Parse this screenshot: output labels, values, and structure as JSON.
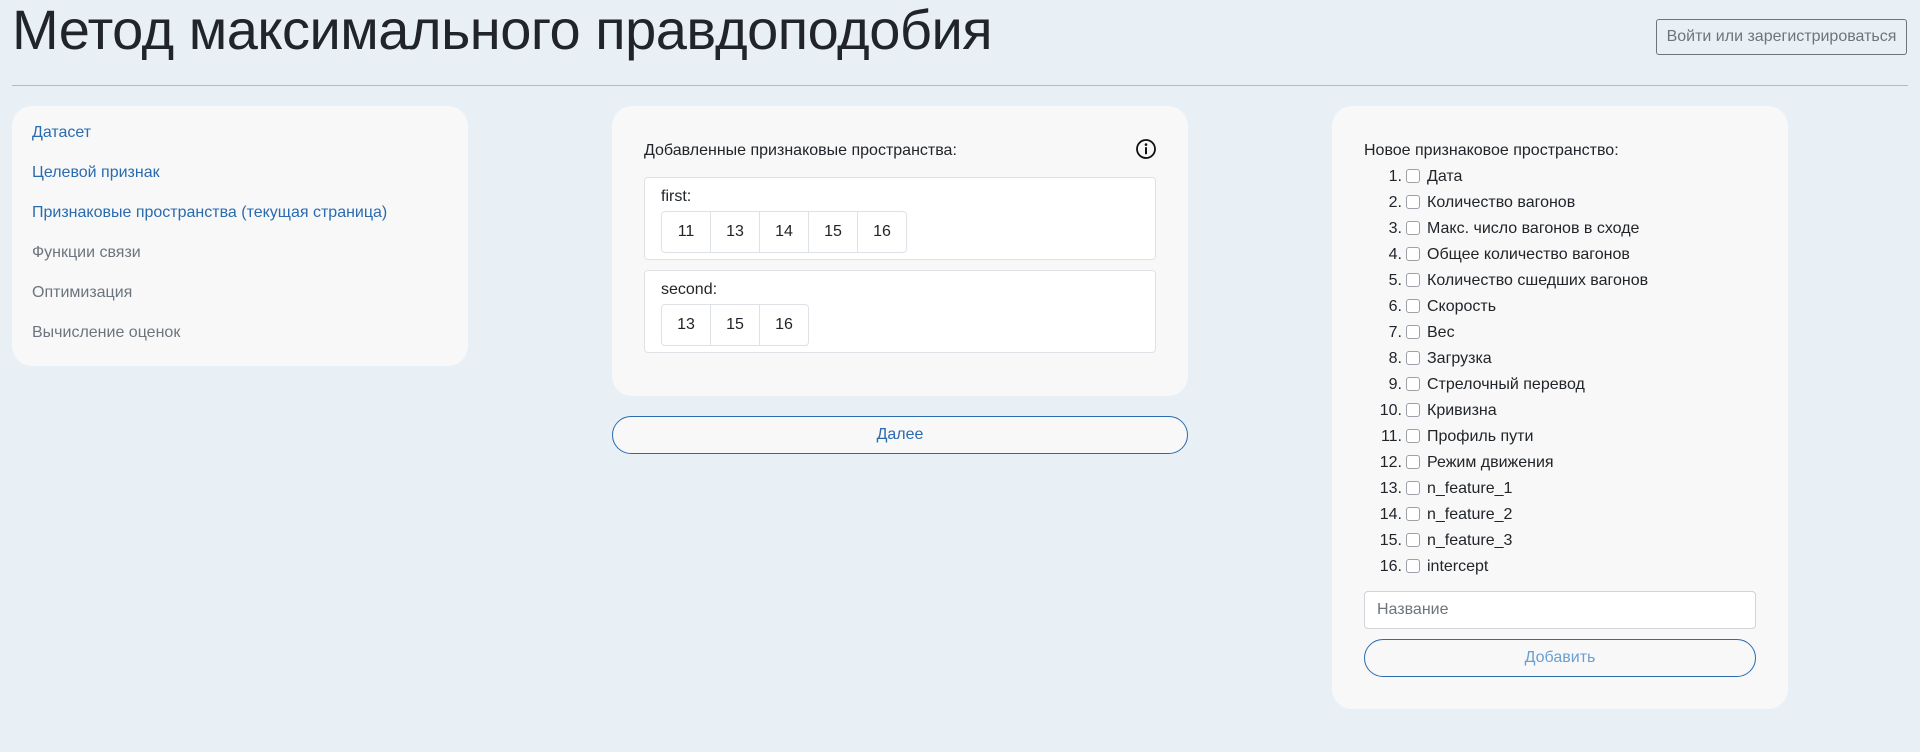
{
  "header": {
    "title": "Метод максимального правдоподобия",
    "login_label": "Войти или зарегистрироваться"
  },
  "nav": {
    "items": [
      {
        "label": "Датасет",
        "state": "link"
      },
      {
        "label": "Целевой признак",
        "state": "link"
      },
      {
        "label": "Признаковые пространства (текущая страница)",
        "state": "link"
      },
      {
        "label": "Функции связи",
        "state": "muted"
      },
      {
        "label": "Оптимизация",
        "state": "muted"
      },
      {
        "label": "Вычисление оценок",
        "state": "muted"
      }
    ]
  },
  "spaces": {
    "title": "Добавленные признаковые пространства:",
    "info_icon": "info-circle-icon",
    "items": [
      {
        "name": "first:",
        "features": [
          "11",
          "13",
          "14",
          "15",
          "16"
        ]
      },
      {
        "name": "second:",
        "features": [
          "13",
          "15",
          "16"
        ]
      }
    ],
    "next_label": "Далее"
  },
  "new_space": {
    "title": "Новое признаковое пространство:",
    "features": [
      {
        "num": "1.",
        "label": "Дата"
      },
      {
        "num": "2.",
        "label": "Количество вагонов"
      },
      {
        "num": "3.",
        "label": "Макс. число вагонов в сходе"
      },
      {
        "num": "4.",
        "label": "Общее количество вагонов"
      },
      {
        "num": "5.",
        "label": "Количество сшедших вагонов"
      },
      {
        "num": "6.",
        "label": "Скорость"
      },
      {
        "num": "7.",
        "label": "Вес"
      },
      {
        "num": "8.",
        "label": "Загрузка"
      },
      {
        "num": "9.",
        "label": "Стрелочный перевод"
      },
      {
        "num": "10.",
        "label": "Кривизна"
      },
      {
        "num": "11.",
        "label": "Профиль пути"
      },
      {
        "num": "12.",
        "label": "Режим движения"
      },
      {
        "num": "13.",
        "label": "n_feature_1"
      },
      {
        "num": "14.",
        "label": "n_feature_2"
      },
      {
        "num": "15.",
        "label": "n_feature_3"
      },
      {
        "num": "16.",
        "label": "intercept"
      }
    ],
    "name_placeholder": "Название",
    "name_value": "",
    "add_label": "Добавить"
  },
  "colors": {
    "background": "#e8f0f6",
    "card": "#f8f8f8",
    "link": "#2a6bb0",
    "muted": "#6c757d"
  }
}
